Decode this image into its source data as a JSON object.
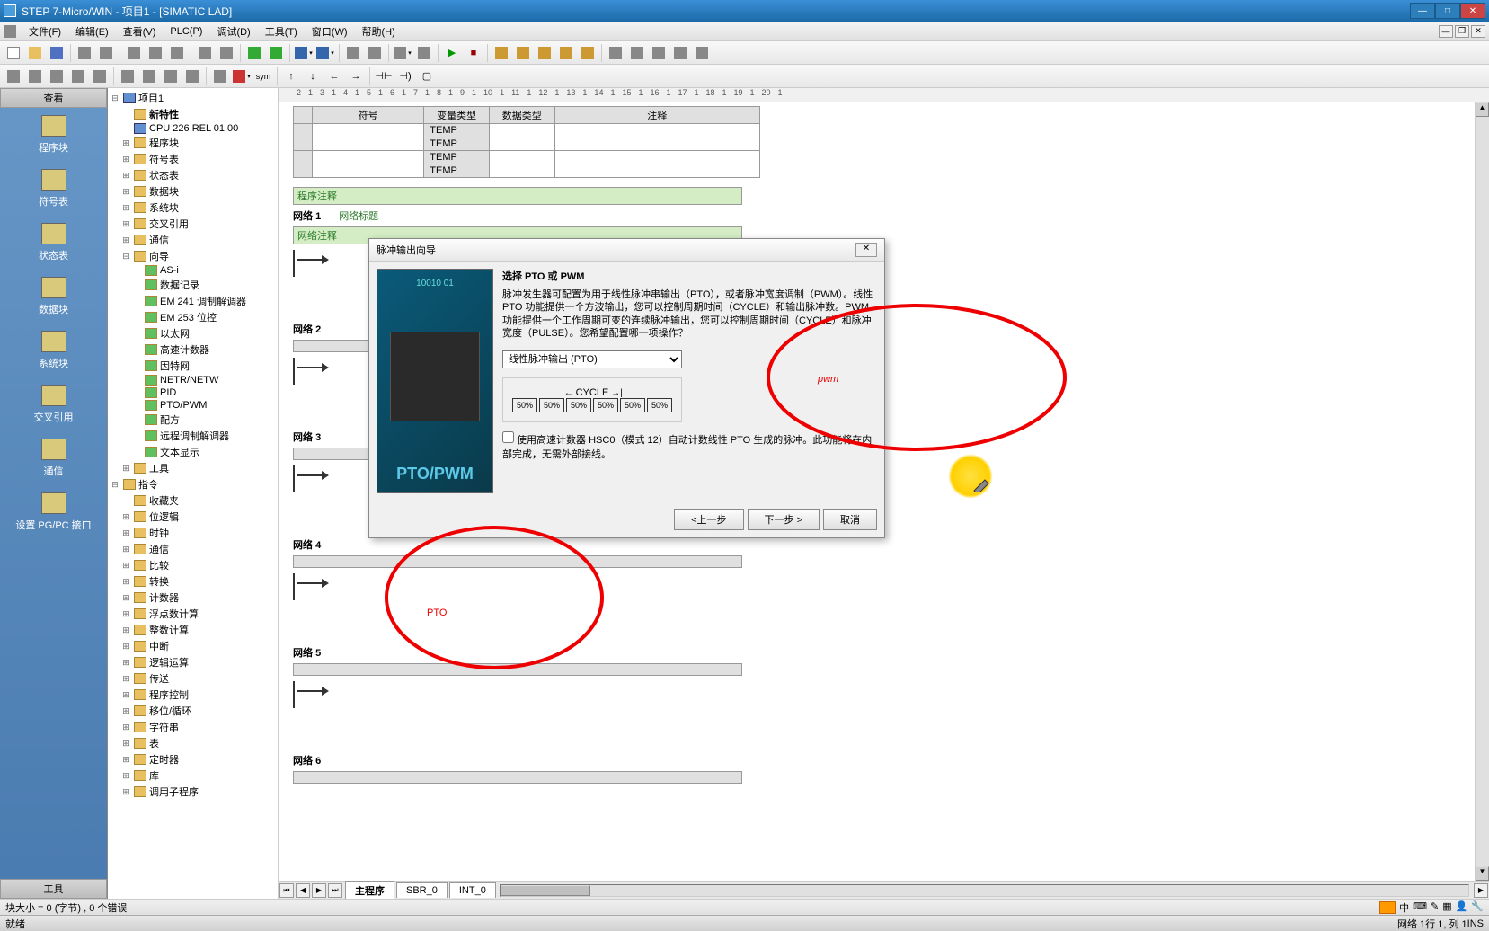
{
  "window": {
    "title": "STEP 7-Micro/WIN - 项目1 - [SIMATIC LAD]"
  },
  "menu": {
    "file": "文件(F)",
    "edit": "编辑(E)",
    "view": "查看(V)",
    "plc": "PLC(P)",
    "debug": "调试(D)",
    "tools": "工具(T)",
    "window": "窗口(W)",
    "help": "帮助(H)"
  },
  "nav": {
    "header": "查看",
    "items": [
      {
        "label": "程序块"
      },
      {
        "label": "符号表"
      },
      {
        "label": "状态表"
      },
      {
        "label": "数据块"
      },
      {
        "label": "系统块"
      },
      {
        "label": "交叉引用"
      },
      {
        "label": "通信"
      },
      {
        "label": "设置 PG/PC 接口"
      }
    ],
    "footer": "工具"
  },
  "tree": {
    "root": "项目1",
    "newfeature": "新特性",
    "cpu": "CPU 226 REL 01.00",
    "progblock": "程序块",
    "symtab": "符号表",
    "stattab": "状态表",
    "datablk": "数据块",
    "sysblk": "系统块",
    "xref": "交叉引用",
    "comm": "通信",
    "wizard": "向导",
    "asi": "AS-i",
    "datarec": "数据记录",
    "em241": "EM 241 调制解调器",
    "em253": "EM 253 位控",
    "ethernet": "以太网",
    "hsc": "高速计数器",
    "internet": "因特网",
    "netr": "NETR/NETW",
    "pid": "PID",
    "ptopwm": "PTO/PWM",
    "recipe": "配方",
    "remotemodem": "远程调制解调器",
    "textdisplay": "文本显示",
    "tools": "工具",
    "instr": "指令",
    "fav": "收藏夹",
    "bitlogic": "位逻辑",
    "clock": "时钟",
    "comm2": "通信",
    "compare": "比较",
    "convert": "转换",
    "counter": "计数器",
    "floatmath": "浮点数计算",
    "intmath": "整数计算",
    "interrupt": "中断",
    "logicop": "逻辑运算",
    "transfer": "传送",
    "progctrl": "程序控制",
    "shiftrot": "移位/循环",
    "string": "字符串",
    "table": "表",
    "timer": "定时器",
    "lib": "库",
    "callsub": "调用子程序"
  },
  "ruler": "2 · 1 · 3 · 1 · 4 · 1 · 5 · 1 · 6 · 1 · 7 · 1 · 8 · 1 · 9 · 1 · 10 · 1 · 11 · 1 · 12 · 1 · 13 · 1 · 14 · 1 · 15 · 1 · 16 · 1 · 17 · 1 · 18 · 1 · 19 · 1 · 20 · 1 ·",
  "symtable": {
    "h_symbol": "符号",
    "h_vartype": "变量类型",
    "h_datatype": "数据类型",
    "h_comment": "注释",
    "temp": "TEMP"
  },
  "ladder": {
    "progcomment": "程序注释",
    "net": "网络",
    "nettitle": "网络标题",
    "netcomment": "网络注释",
    "n1": "1",
    "n2": "2",
    "n3": "3",
    "n4": "4",
    "n5": "5",
    "n6": "6"
  },
  "tabs": {
    "main": "主程序",
    "sbr": "SBR_0",
    "int": "INT_0"
  },
  "dialog": {
    "title": "脉冲输出向导",
    "heading": "选择 PTO 或 PWM",
    "text": "脉冲发生器可配置为用于线性脉冲串输出（PTO），或者脉冲宽度调制（PWM）。线性 PTO 功能提供一个方波输出，您可以控制周期时间（CYCLE）和输出脉冲数。PWM 功能提供一个工作周期可变的连续脉冲输出，您可以控制周期时间（CYCLE）和脉冲宽度（PULSE）。您希望配置哪一项操作？",
    "select": "线性脉冲输出 (PTO)",
    "cycle": "CYCLE",
    "pct": "50%",
    "checkbox": "使用高速计数器 HSC0（模式 12）自动计数线性 PTO 生成的脉冲。此功能将在内部完成，无需外部接线。",
    "imglabel": "PTO/PWM",
    "prev": "<上一步",
    "next": "下一步 >",
    "cancel": "取消"
  },
  "status": {
    "left": "块大小 = 0 (字节) , 0 个错误",
    "ready": "就绪",
    "net": "网络 1",
    "pos": "行 1, 列 1",
    "ins": "INS"
  },
  "annotations": {
    "pwm_text": "pwm",
    "pto_text": "PTO"
  }
}
